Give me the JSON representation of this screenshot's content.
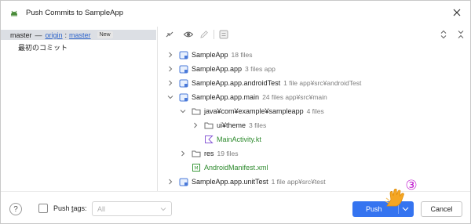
{
  "window": {
    "title": "Push Commits to SampleApp",
    "close_icon": "close-icon",
    "app_icon": "android-icon"
  },
  "left": {
    "branch": "master",
    "separator": "—",
    "remote": "origin",
    "colon": ":",
    "target": "master",
    "badge": "New",
    "commit_message": "最初のコミット"
  },
  "toolbar": {
    "icons": [
      "collapse-arrows-icon",
      "eye-icon",
      "edit-icon",
      "diff-icon",
      "expand-all-icon",
      "collapse-all-icon"
    ]
  },
  "tree": {
    "nodes": [
      {
        "label": "SampleApp",
        "meta": "18 files",
        "expanded": false
      },
      {
        "label": "SampleApp.app",
        "meta": "3 files  app",
        "expanded": false
      },
      {
        "label": "SampleApp.app.androidTest",
        "meta": "1 file  app¥src¥androidTest",
        "expanded": false
      },
      {
        "label": "SampleApp.app.main",
        "meta": "24 files  app¥src¥main",
        "expanded": true
      },
      {
        "label": "java¥com¥example¥sampleapp",
        "meta": "4 files",
        "expanded": true
      },
      {
        "label": "ui¥theme",
        "meta": "3 files",
        "expanded": false
      },
      {
        "label": "MainActivity.kt",
        "meta": ""
      },
      {
        "label": "res",
        "meta": "19 files",
        "expanded": false
      },
      {
        "label": "AndroidManifest.xml",
        "meta": ""
      },
      {
        "label": "SampleApp.app.unitTest",
        "meta": "1 file  app¥src¥test",
        "expanded": false
      }
    ]
  },
  "footer": {
    "help": "?",
    "push_tags_label_prefix": "Push ",
    "push_tags_label_underlined": "t",
    "push_tags_label_suffix": "ags:",
    "tags_select_value": "All",
    "push_label": "Push",
    "cancel_label": "Cancel",
    "step_marker": "③"
  },
  "colors": {
    "accent": "#3574f0",
    "link": "#2f65ca",
    "new_file_green": "#2d8a2d",
    "selection": "#dcdfe4",
    "step_marker": "#c21fd1",
    "pointer": "#f5a623"
  }
}
